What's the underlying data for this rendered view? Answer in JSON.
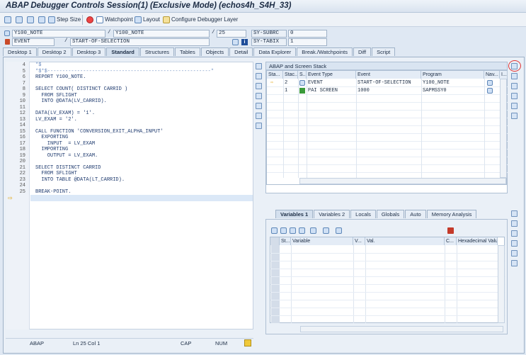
{
  "title": "ABAP Debugger Controls Session(1)  (Exclusive Mode) (echos4h_S4H_33)",
  "toolbar": {
    "step_size": "Step Size",
    "watchpoint": "Watchpoint",
    "layout": "Layout",
    "configure": "Configure Debugger Layer"
  },
  "info": {
    "program1": "Y100_NOTE",
    "program2": "Y100_NOTE",
    "line": "25",
    "event_type": "EVENT",
    "event_name": "START-OF-SELECTION",
    "sysubrc_label": "SY-SUBRC",
    "sysubrc_value": "0",
    "sytabix_label": "SY-TABIX",
    "sytabix_value": "1"
  },
  "tabs": [
    "Desktop 1",
    "Desktop 2",
    "Desktop 3",
    "Standard",
    "Structures",
    "Tables",
    "Objects",
    "Detail",
    "Data Explorer",
    "Break./Watchpoints",
    "Diff",
    "Script"
  ],
  "code": [
    {
      "n": "4",
      "t": "*$"
    },
    {
      "n": "5",
      "t": "*$*$-------------------------------------------------------*"
    },
    {
      "n": "6",
      "t": "REPORT Y100_NOTE."
    },
    {
      "n": "7",
      "t": ""
    },
    {
      "n": "8",
      "t": "SELECT COUNT( DISTINCT CARRID )"
    },
    {
      "n": "9",
      "t": "  FROM SFLIGHT"
    },
    {
      "n": "10",
      "t": "  INTO @DATA(LV_CARRID)."
    },
    {
      "n": "11",
      "t": ""
    },
    {
      "n": "12",
      "t": "DATA(LV_EXAM) = '1'."
    },
    {
      "n": "13",
      "t": "LV_EXAM = '2'."
    },
    {
      "n": "14",
      "t": ""
    },
    {
      "n": "15",
      "t": "CALL FUNCTION 'CONVERSION_EXIT_ALPHA_INPUT'"
    },
    {
      "n": "16",
      "t": "  EXPORTING"
    },
    {
      "n": "17",
      "t": "    INPUT  = LV_EXAM"
    },
    {
      "n": "18",
      "t": "  IMPORTING"
    },
    {
      "n": "19",
      "t": "    OUTPUT = LV_EXAM."
    },
    {
      "n": "20",
      "t": ""
    },
    {
      "n": "21",
      "t": "SELECT DISTINCT CARRID"
    },
    {
      "n": "22",
      "t": "  FROM SFLIGHT"
    },
    {
      "n": "23",
      "t": "  INTO TABLE @DATA(LT_CARRID)."
    },
    {
      "n": "24",
      "t": ""
    },
    {
      "n": "25",
      "t": "BREAK-POINT."
    }
  ],
  "editor_status": {
    "lang": "ABAP",
    "pos": "Ln 25 Col 1",
    "cap": "CAP",
    "num": "NUM"
  },
  "stack": {
    "title": "ABAP and Screen Stack",
    "headers": [
      "Sta...",
      "Stac...",
      "S...",
      "Event Type",
      "Event",
      "Program",
      "Nav...",
      "I..."
    ],
    "rows": [
      {
        "level": "2",
        "type": "EVENT",
        "event": "START-OF-SELECTION",
        "program": "Y100_NOTE",
        "i": "Y"
      },
      {
        "level": "1",
        "type": "PAI SCREEN",
        "event": "1000",
        "program": "SAPMSSY0",
        "i": ""
      }
    ]
  },
  "vartabs": [
    "Variables 1",
    "Variables 2",
    "Locals",
    "Globals",
    "Auto",
    "Memory Analysis"
  ],
  "vars": {
    "headers": [
      "St...",
      "Variable",
      "V...",
      "Val.",
      "C...",
      "Hexadecimal Value"
    ]
  },
  "colors": {
    "accent": "#e03030",
    "highlight": "#dbe8f7"
  }
}
